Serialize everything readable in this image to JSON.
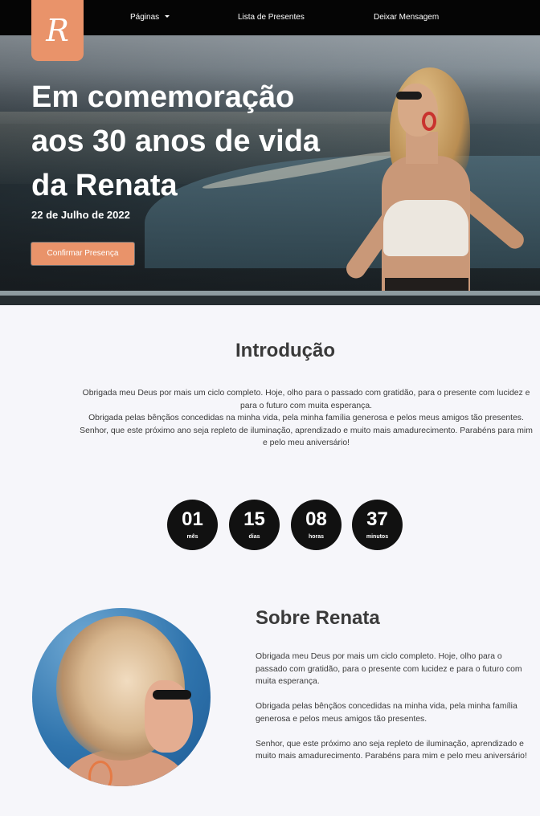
{
  "nav": {
    "logo_letter": "R",
    "items": [
      {
        "label": "Páginas"
      },
      {
        "label": "Lista de Presentes"
      },
      {
        "label": "Deixar Mensagem"
      }
    ]
  },
  "hero": {
    "title": "Em comemoração aos 30 anos de vida da Renata",
    "date": "22 de Julho de 2022",
    "button_label": "Confirmar Presença"
  },
  "intro": {
    "title": "Introdução",
    "paragraphs": [
      "Obrigada meu Deus por mais um ciclo completo. Hoje, olho para o passado com gratidão, para o presente com lucidez e para o futuro com muita esperança.",
      "Obrigada pelas bênçãos concedidas na minha vida, pela minha família generosa e pelos meus amigos tão presentes.",
      "Senhor, que este próximo ano seja repleto de iluminação, aprendizado e muito mais amadurecimento. Parabéns para mim e pelo meu aniversário!"
    ]
  },
  "countdown": [
    {
      "value": "01",
      "label": "mês"
    },
    {
      "value": "15",
      "label": "dias"
    },
    {
      "value": "08",
      "label": "horas"
    },
    {
      "value": "37",
      "label": "minutos"
    }
  ],
  "about": {
    "title": "Sobre Renata",
    "paragraphs": [
      "Obrigada meu Deus por mais um ciclo completo. Hoje, olho para o passado com gratidão, para o presente com lucidez e para o futuro com muita esperança.",
      "Obrigada pelas bênçãos concedidas na minha vida, pela minha família generosa e pelos meus amigos tão presentes.",
      "Senhor, que este próximo ano seja repleto de iluminação, aprendizado e muito mais amadurecimento. Parabéns para mim e pelo meu aniversário!"
    ]
  },
  "colors": {
    "accent": "#e9936a",
    "nav_bg": "#050505",
    "page_bg": "#f6f6fa",
    "countdown_bg": "#111111"
  }
}
